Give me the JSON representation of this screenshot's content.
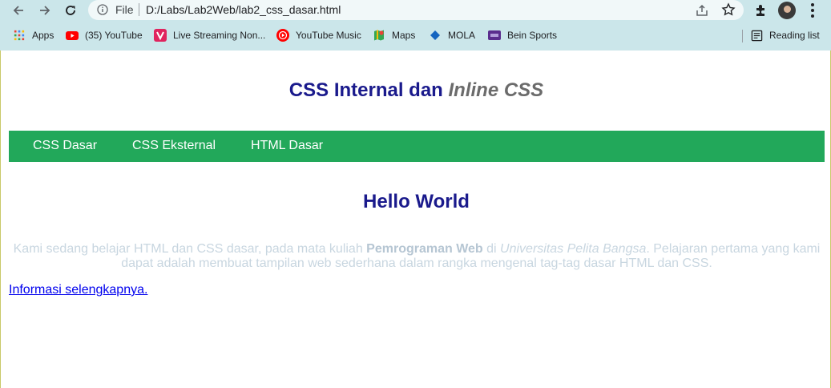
{
  "browser": {
    "omnibox": {
      "scheme_label": "File",
      "url": "D:/Labs/Lab2Web/lab2_css_dasar.html"
    },
    "bookmarks": [
      {
        "label": "Apps",
        "icon": "apps-grid-icon"
      },
      {
        "label": "(35) YouTube",
        "icon": "youtube-icon"
      },
      {
        "label": "Live Streaming Non...",
        "icon": "vidio-icon"
      },
      {
        "label": "YouTube Music",
        "icon": "youtube-music-icon"
      },
      {
        "label": "Maps",
        "icon": "google-maps-icon"
      },
      {
        "label": "MOLA",
        "icon": "mola-icon"
      },
      {
        "label": "Bein Sports",
        "icon": "bein-sports-icon"
      }
    ],
    "reading_list": {
      "label": "Reading list",
      "icon": "reading-list-icon"
    }
  },
  "page": {
    "title_main": "CSS Internal dan ",
    "title_italic": "Inline CSS",
    "nav": [
      {
        "label": "CSS Dasar"
      },
      {
        "label": "CSS Eksternal"
      },
      {
        "label": "HTML Dasar"
      }
    ],
    "heading": "Hello World",
    "intro": {
      "part1": "Kami sedang belajar HTML dan CSS dasar, pada mata kuliah ",
      "bold": "Pemrograman Web",
      "part2": " di ",
      "italic": "Universitas Pelita Bangsa",
      "part3": ". Pelajaran pertama yang kami dapat adalah membuat tampilan web sederhana dalam rangka mengenal tag-tag dasar HTML dan CSS."
    },
    "more_link": "Informasi selengkapnya."
  },
  "colors": {
    "chrome_bg": "#cbe6ea",
    "navbar_bg": "#22a85a",
    "heading": "#1a1a8c",
    "intro_text": "#c8d6e0",
    "link": "#0000ee"
  }
}
